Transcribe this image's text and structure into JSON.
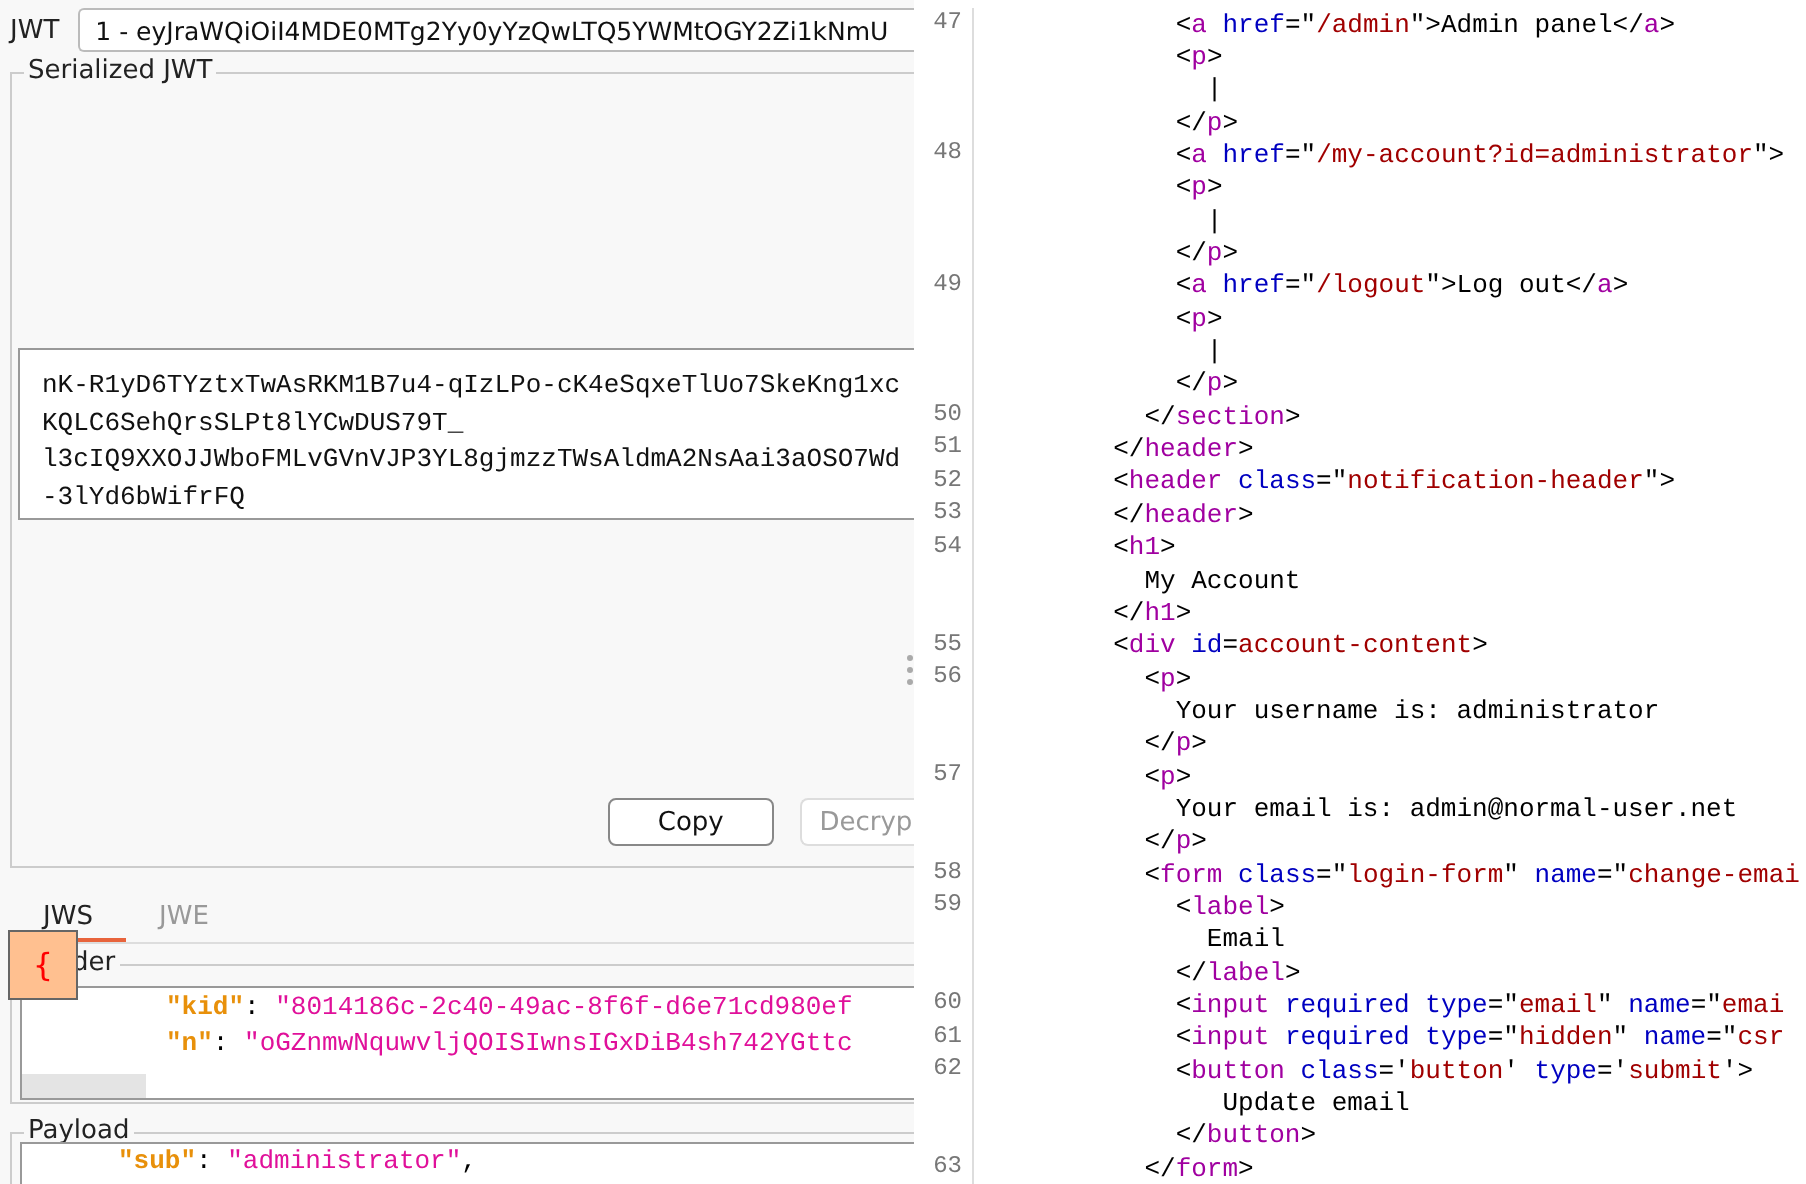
{
  "jwt_selector": {
    "label": "JWT",
    "value": "1 - eyJraWQiOiI4MDE0MTg2Yy0yYzQwLTQ5YWMtOGY2Zi1kNmU"
  },
  "serialized": {
    "legend": "Serialized JWT",
    "lines": [
      "nK-R1yD6TYztxTwAsRKM1B7u4-qIzLPo-cK4eSqxeTlUo7SkeKng1xc",
      "KQLC6SehQrsSLPt8lYCwDUS79T_",
      "l3cIQ9XXOJJWboFMLvGVnVJP3YL8gjmzzTWsAldmA2NsAai3aOSO7Wd",
      "-3lYd6bWifrFQ"
    ],
    "buttons": [
      {
        "label": "Copy",
        "disabled": false
      },
      {
        "label": "Decryp",
        "disabled": true
      }
    ]
  },
  "tabs": [
    {
      "label": "JWS",
      "selected": true
    },
    {
      "label": "JWE",
      "selected": false
    }
  ],
  "header": {
    "legend": "der",
    "overlay": "{",
    "lines": [
      [
        {
          "kind": "key",
          "text": "\"kid\""
        },
        {
          "kind": "plain",
          "text": ": "
        },
        {
          "kind": "str",
          "text": "\"8014186c-2c40-49ac-8f6f-d6e71cd980ef"
        }
      ],
      [
        {
          "kind": "key",
          "text": "\"n\""
        },
        {
          "kind": "plain",
          "text": ": "
        },
        {
          "kind": "str",
          "text": "\"oGZnmwNquwvljQOISIwnsIGxDiB4sh742YGttc"
        }
      ]
    ]
  },
  "payload": {
    "legend": "Payload",
    "lines": [
      [
        {
          "kind": "key",
          "text": "\"sub\""
        },
        {
          "kind": "plain",
          "text": ": "
        },
        {
          "kind": "str",
          "text": "\"administrator\""
        },
        {
          "kind": "plain",
          "text": ","
        }
      ]
    ]
  },
  "code": {
    "rows": [
      {
        "number": "47",
        "tokens": [
          {
            "kind": "plain",
            "text": "           <"
          },
          {
            "kind": "tag",
            "text": "a"
          },
          {
            "kind": "attr",
            "text": " href"
          },
          {
            "kind": "plain",
            "text": "=\""
          },
          {
            "kind": "val",
            "text": "/admin"
          },
          {
            "kind": "plain",
            "text": "\">Admin panel</"
          },
          {
            "kind": "tag",
            "text": "a"
          },
          {
            "kind": "plain",
            "text": ">"
          }
        ]
      },
      {
        "tokens": [
          {
            "kind": "plain",
            "text": "           <"
          },
          {
            "kind": "tag",
            "text": "p"
          },
          {
            "kind": "plain",
            "text": ">"
          }
        ]
      },
      {
        "tokens": [
          {
            "kind": "plain",
            "text": "             |"
          }
        ]
      },
      {
        "tokens": [
          {
            "kind": "plain",
            "text": "           </"
          },
          {
            "kind": "tag",
            "text": "p"
          },
          {
            "kind": "plain",
            "text": ">"
          }
        ]
      },
      {
        "number": "48",
        "tokens": [
          {
            "kind": "plain",
            "text": "           <"
          },
          {
            "kind": "tag",
            "text": "a"
          },
          {
            "kind": "attr",
            "text": " href"
          },
          {
            "kind": "plain",
            "text": "=\""
          },
          {
            "kind": "val",
            "text": "/my-account?id=administrator"
          },
          {
            "kind": "plain",
            "text": "\">"
          }
        ]
      },
      {
        "tokens": [
          {
            "kind": "plain",
            "text": "           <"
          },
          {
            "kind": "tag",
            "text": "p"
          },
          {
            "kind": "plain",
            "text": ">"
          }
        ]
      },
      {
        "tokens": [
          {
            "kind": "plain",
            "text": "             |"
          }
        ]
      },
      {
        "tokens": [
          {
            "kind": "plain",
            "text": "           </"
          },
          {
            "kind": "tag",
            "text": "p"
          },
          {
            "kind": "plain",
            "text": ">"
          }
        ]
      },
      {
        "number": "49",
        "tokens": [
          {
            "kind": "plain",
            "text": "           <"
          },
          {
            "kind": "tag",
            "text": "a"
          },
          {
            "kind": "attr",
            "text": " href"
          },
          {
            "kind": "plain",
            "text": "=\""
          },
          {
            "kind": "val",
            "text": "/logout"
          },
          {
            "kind": "plain",
            "text": "\">Log out</"
          },
          {
            "kind": "tag",
            "text": "a"
          },
          {
            "kind": "plain",
            "text": ">"
          }
        ]
      },
      {
        "tokens": [
          {
            "kind": "plain",
            "text": "           <"
          },
          {
            "kind": "tag",
            "text": "p"
          },
          {
            "kind": "plain",
            "text": ">"
          }
        ]
      },
      {
        "tokens": [
          {
            "kind": "plain",
            "text": "             |"
          }
        ]
      },
      {
        "tokens": [
          {
            "kind": "plain",
            "text": "           </"
          },
          {
            "kind": "tag",
            "text": "p"
          },
          {
            "kind": "plain",
            "text": ">"
          }
        ]
      },
      {
        "number": "50",
        "tokens": [
          {
            "kind": "plain",
            "text": "         </"
          },
          {
            "kind": "tag",
            "text": "section"
          },
          {
            "kind": "plain",
            "text": ">"
          }
        ]
      },
      {
        "number": "51",
        "tokens": [
          {
            "kind": "plain",
            "text": "       </"
          },
          {
            "kind": "tag",
            "text": "header"
          },
          {
            "kind": "plain",
            "text": ">"
          }
        ]
      },
      {
        "number": "52",
        "tokens": [
          {
            "kind": "plain",
            "text": "       <"
          },
          {
            "kind": "tag",
            "text": "header"
          },
          {
            "kind": "attr",
            "text": " class"
          },
          {
            "kind": "plain",
            "text": "=\""
          },
          {
            "kind": "val",
            "text": "notification-header"
          },
          {
            "kind": "plain",
            "text": "\">"
          }
        ]
      },
      {
        "number": "53",
        "tokens": [
          {
            "kind": "plain",
            "text": "       </"
          },
          {
            "kind": "tag",
            "text": "header"
          },
          {
            "kind": "plain",
            "text": ">"
          }
        ]
      },
      {
        "number": "54",
        "tokens": [
          {
            "kind": "plain",
            "text": "       <"
          },
          {
            "kind": "tag",
            "text": "h1"
          },
          {
            "kind": "plain",
            "text": ">"
          }
        ]
      },
      {
        "tokens": [
          {
            "kind": "plain",
            "text": "         My Account"
          }
        ]
      },
      {
        "tokens": [
          {
            "kind": "plain",
            "text": "       </"
          },
          {
            "kind": "tag",
            "text": "h1"
          },
          {
            "kind": "plain",
            "text": ">"
          }
        ]
      },
      {
        "number": "55",
        "tokens": [
          {
            "kind": "plain",
            "text": "       <"
          },
          {
            "kind": "tag",
            "text": "div"
          },
          {
            "kind": "attr",
            "text": " id"
          },
          {
            "kind": "plain",
            "text": "="
          },
          {
            "kind": "val",
            "text": "account-content"
          },
          {
            "kind": "plain",
            "text": ">"
          }
        ]
      },
      {
        "number": "56",
        "tokens": [
          {
            "kind": "plain",
            "text": "         <"
          },
          {
            "kind": "tag",
            "text": "p"
          },
          {
            "kind": "plain",
            "text": ">"
          }
        ]
      },
      {
        "tokens": [
          {
            "kind": "plain",
            "text": "           Your username is: administrator"
          }
        ]
      },
      {
        "tokens": [
          {
            "kind": "plain",
            "text": "         </"
          },
          {
            "kind": "tag",
            "text": "p"
          },
          {
            "kind": "plain",
            "text": ">"
          }
        ]
      },
      {
        "number": "57",
        "tokens": [
          {
            "kind": "plain",
            "text": "         <"
          },
          {
            "kind": "tag",
            "text": "p"
          },
          {
            "kind": "plain",
            "text": ">"
          }
        ]
      },
      {
        "tokens": [
          {
            "kind": "plain",
            "text": "           Your email is: admin@normal-user.net"
          }
        ]
      },
      {
        "tokens": [
          {
            "kind": "plain",
            "text": "         </"
          },
          {
            "kind": "tag",
            "text": "p"
          },
          {
            "kind": "plain",
            "text": ">"
          }
        ]
      },
      {
        "number": "58",
        "tokens": [
          {
            "kind": "plain",
            "text": "         <"
          },
          {
            "kind": "tag",
            "text": "form"
          },
          {
            "kind": "attr",
            "text": " class"
          },
          {
            "kind": "plain",
            "text": "=\""
          },
          {
            "kind": "val",
            "text": "login-form"
          },
          {
            "kind": "plain",
            "text": "\" "
          },
          {
            "kind": "attr",
            "text": "name"
          },
          {
            "kind": "plain",
            "text": "=\""
          },
          {
            "kind": "val",
            "text": "change-emai"
          }
        ]
      },
      {
        "number": "59",
        "tokens": [
          {
            "kind": "plain",
            "text": "           <"
          },
          {
            "kind": "tag",
            "text": "label"
          },
          {
            "kind": "plain",
            "text": ">"
          }
        ]
      },
      {
        "tokens": [
          {
            "kind": "plain",
            "text": "             Email"
          }
        ]
      },
      {
        "tokens": [
          {
            "kind": "plain",
            "text": "           </"
          },
          {
            "kind": "tag",
            "text": "label"
          },
          {
            "kind": "plain",
            "text": ">"
          }
        ]
      },
      {
        "number": "60",
        "tokens": [
          {
            "kind": "plain",
            "text": "           <"
          },
          {
            "kind": "tag",
            "text": "input"
          },
          {
            "kind": "attr",
            "text": " required type"
          },
          {
            "kind": "plain",
            "text": "=\""
          },
          {
            "kind": "val",
            "text": "email"
          },
          {
            "kind": "plain",
            "text": "\" "
          },
          {
            "kind": "attr",
            "text": "name"
          },
          {
            "kind": "plain",
            "text": "=\""
          },
          {
            "kind": "val",
            "text": "emai"
          }
        ]
      },
      {
        "number": "61",
        "tokens": [
          {
            "kind": "plain",
            "text": "           <"
          },
          {
            "kind": "tag",
            "text": "input"
          },
          {
            "kind": "attr",
            "text": " required type"
          },
          {
            "kind": "plain",
            "text": "=\""
          },
          {
            "kind": "val",
            "text": "hidden"
          },
          {
            "kind": "plain",
            "text": "\" "
          },
          {
            "kind": "attr",
            "text": "name"
          },
          {
            "kind": "plain",
            "text": "=\""
          },
          {
            "kind": "val",
            "text": "csr"
          }
        ]
      },
      {
        "number": "62",
        "tokens": [
          {
            "kind": "plain",
            "text": "           <"
          },
          {
            "kind": "tag",
            "text": "button"
          },
          {
            "kind": "attr",
            "text": " class"
          },
          {
            "kind": "plain",
            "text": "='"
          },
          {
            "kind": "val",
            "text": "button"
          },
          {
            "kind": "plain",
            "text": "' "
          },
          {
            "kind": "attr",
            "text": "type"
          },
          {
            "kind": "plain",
            "text": "='"
          },
          {
            "kind": "val",
            "text": "submit"
          },
          {
            "kind": "plain",
            "text": "'>"
          }
        ]
      },
      {
        "tokens": [
          {
            "kind": "plain",
            "text": "              Update email"
          }
        ]
      },
      {
        "tokens": [
          {
            "kind": "plain",
            "text": "           </"
          },
          {
            "kind": "tag",
            "text": "button"
          },
          {
            "kind": "plain",
            "text": ">"
          }
        ]
      },
      {
        "number": "63",
        "tokens": [
          {
            "kind": "plain",
            "text": "         </"
          },
          {
            "kind": "tag",
            "text": "form"
          },
          {
            "kind": "plain",
            "text": ">"
          }
        ]
      }
    ]
  }
}
